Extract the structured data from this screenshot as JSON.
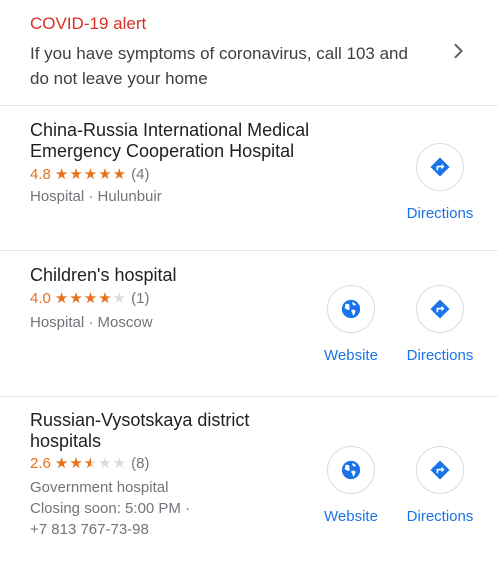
{
  "alert": {
    "title": "COVID-19 alert",
    "text": "If you have symptoms of coronavirus, call 103 and do not leave your home",
    "icon": "chevron-right-icon"
  },
  "colors": {
    "alert_red": "#d93025",
    "star_orange": "#e7711b",
    "link_blue": "#1a73e8"
  },
  "places": [
    {
      "name": "China-Russia International Medical Emergency Cooperation Hospital",
      "rating": "4.8",
      "stars": 4.8,
      "reviews": "(4)",
      "meta_lines": [
        "Hospital · Hulunbuir"
      ],
      "website_label": null,
      "directions_label": "Directions"
    },
    {
      "name": "Children's hospital",
      "rating": "4.0",
      "stars": 4.0,
      "reviews": "(1)",
      "meta_lines": [
        "Hospital · Moscow"
      ],
      "website_label": "Website",
      "directions_label": "Directions"
    },
    {
      "name": "Russian-Vysotskaya district hospitals",
      "rating": "2.6",
      "stars": 2.6,
      "reviews": "(8)",
      "meta_lines": [
        "Government hospital",
        "Closing soon: 5:00 PM ·",
        "+7 813 767-73-98"
      ],
      "website_label": "Website",
      "directions_label": "Directions"
    }
  ]
}
